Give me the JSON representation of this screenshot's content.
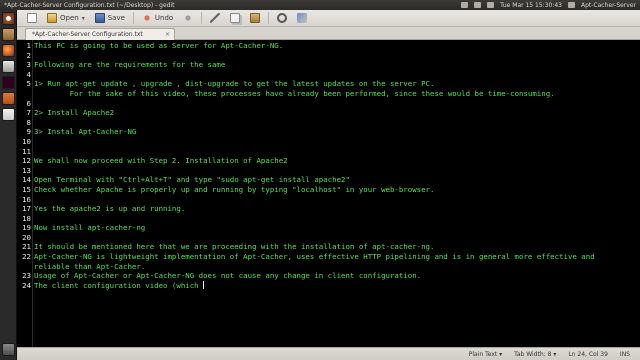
{
  "panel": {
    "title": "*Apt-Cacher-Server Configuration.txt (~/Desktop) - gedit",
    "clock": "Tue Mar 15 15:30:43",
    "user": "Apt-Cacher-Server"
  },
  "toolbar": {
    "open_label": "Open",
    "save_label": "Save",
    "undo_label": "Undo"
  },
  "tab": {
    "label": "*Apt-Cacher-Server Configuration.txt",
    "close": "×"
  },
  "editor": {
    "text_color": "#4ee44e",
    "lines": [
      {
        "n": "1",
        "text": "This PC is going to be used as Server for Apt-Cacher-NG."
      },
      {
        "n": "2",
        "text": ""
      },
      {
        "n": "3",
        "text": "Following are the requirements for the same"
      },
      {
        "n": "4",
        "text": ""
      },
      {
        "n": "5",
        "text": "1> Run apt-get update , upgrade , dist-upgrade to get the latest updates on the server PC.\n        For the sake of this video, these processes have already been performed, since these would be time-consuming."
      },
      {
        "n": "6",
        "text": ""
      },
      {
        "n": "7",
        "text": "2> Install Apache2"
      },
      {
        "n": "8",
        "text": ""
      },
      {
        "n": "9",
        "text": "3> Instal Apt-Cacher-NG"
      },
      {
        "n": "10",
        "text": ""
      },
      {
        "n": "11",
        "text": ""
      },
      {
        "n": "12",
        "text": "We shall now proceed with Step 2. Installation of Apache2"
      },
      {
        "n": "13",
        "text": ""
      },
      {
        "n": "14",
        "text": "Open Terminal with \"Ctrl+Alt+T\" and type \"sudo apt-get install apache2\""
      },
      {
        "n": "15",
        "text": "Check whether Apache is properly up and running by typing \"localhost\" in your web-browser."
      },
      {
        "n": "16",
        "text": ""
      },
      {
        "n": "17",
        "text": "Yes the apache2 is up and running."
      },
      {
        "n": "18",
        "text": ""
      },
      {
        "n": "19",
        "text": "Now install apt-cacher-ng"
      },
      {
        "n": "20",
        "text": ""
      },
      {
        "n": "21",
        "text": "It should be mentioned here that we are proceeding with the installation of apt-cacher-ng."
      },
      {
        "n": "22",
        "text": "Apt-Cacher-NG is lightweight implementation of Apt-Cacher, uses effective HTTP pipelining and is in general more effective and\nreliable than Apt-Cacher."
      },
      {
        "n": "23",
        "text": "Usage of Apt-Cacher or Apt-Cacher-NG does not cause any change in client configuration."
      },
      {
        "n": "24",
        "text": "The client configuration video (which "
      }
    ]
  },
  "status": {
    "syntax": "Plain Text ▾",
    "tab_width": "Tab Width: 8 ▾",
    "position": "Ln 24, Col 39",
    "mode": "INS"
  }
}
